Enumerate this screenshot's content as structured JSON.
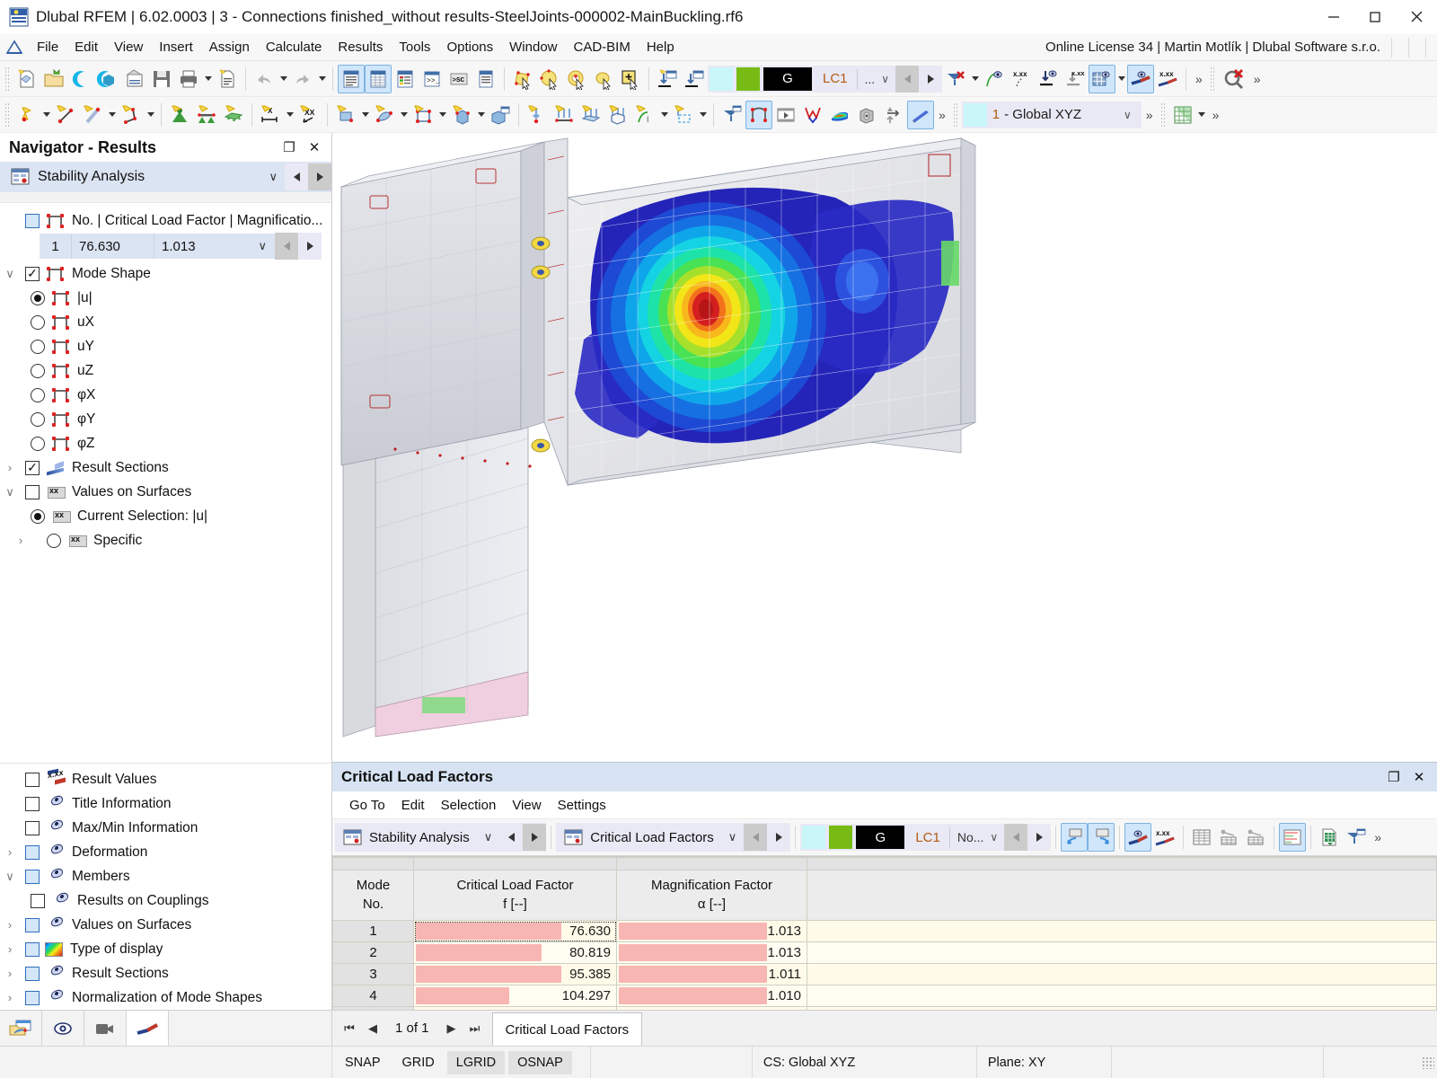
{
  "window": {
    "title": "Dlubal RFEM | 6.02.0003 | 3 - Connections finished_without results-SteelJoints-000002-MainBuckling.rf6",
    "minimize": "—",
    "maximize": "☐",
    "close": "✕"
  },
  "menubar": {
    "items": [
      "File",
      "Edit",
      "View",
      "Insert",
      "Assign",
      "Calculate",
      "Results",
      "Tools",
      "Options",
      "Window",
      "CAD-BIM",
      "Help"
    ],
    "license": "Online License 34 | Martin Motlík | Dlubal Software s.r.o."
  },
  "toolbar": {
    "load_case_selector": {
      "swatch_cyan": "#c9f6f9",
      "swatch_green": "#77bb14",
      "g_label": "G",
      "lc_label": "LC1",
      "dots": "...",
      "chevron": "∨"
    },
    "cs_selector": {
      "number": "1",
      "label": "- Global XYZ",
      "chevron": "∨"
    },
    "overflow": "»"
  },
  "navigator": {
    "title": "Navigator - Results",
    "undock_icon": "❐",
    "close_icon": "✕",
    "combo": {
      "label": "Stability Analysis",
      "chevron": "∨"
    },
    "tree": [
      {
        "label": "No. | Critical Load Factor | Magnificatio...",
        "icon": "frame-icon",
        "control": "checkbox-blue",
        "indent": 1
      },
      {
        "label": "Mode Shape",
        "icon": "frame-icon",
        "control": "checkbox-checked",
        "indent": 1,
        "expander": "∨"
      },
      {
        "label": "|u|",
        "icon": "frame-icon",
        "control": "radio-selected",
        "indent": 2
      },
      {
        "label": "uX",
        "icon": "frame-icon",
        "control": "radio",
        "indent": 2
      },
      {
        "label": "uY",
        "icon": "frame-icon",
        "control": "radio",
        "indent": 2
      },
      {
        "label": "uZ",
        "icon": "frame-icon",
        "control": "radio",
        "indent": 2
      },
      {
        "label": "φX",
        "icon": "frame-icon",
        "control": "radio",
        "indent": 2
      },
      {
        "label": "φY",
        "icon": "frame-icon",
        "control": "radio",
        "indent": 2
      },
      {
        "label": "φZ",
        "icon": "frame-icon",
        "control": "radio",
        "indent": 2
      },
      {
        "label": "Result Sections",
        "icon": "swoosh-icon",
        "control": "checkbox-checked",
        "indent": 1,
        "expander": "›"
      },
      {
        "label": "Values on Surfaces",
        "icon": "xx-tag-icon",
        "control": "checkbox",
        "indent": 1,
        "expander": "∨"
      },
      {
        "label": "Current Selection: |u|",
        "icon": "xx-tag-icon",
        "control": "radio-selected",
        "indent": 2
      },
      {
        "label": "Specific",
        "icon": "xx-tag-icon",
        "control": "radio",
        "indent": 2,
        "expander": "›"
      }
    ],
    "mode_row": {
      "no": "1",
      "critical_load_factor": "76.630",
      "magnification_factor": "1.013",
      "chevron": "∨"
    },
    "tree_bottom": [
      {
        "label": "Result Values",
        "icon": "result-values-icon",
        "control": "checkbox",
        "indent": 1
      },
      {
        "label": "Title Information",
        "icon": "eye-line-icon",
        "control": "checkbox",
        "indent": 1
      },
      {
        "label": "Max/Min Information",
        "icon": "eye-line-icon",
        "control": "checkbox",
        "indent": 1
      },
      {
        "label": "Deformation",
        "icon": "eye-line-icon",
        "control": "checkbox-blue",
        "indent": 1,
        "expander": "›"
      },
      {
        "label": "Members",
        "icon": "eye-line-icon",
        "control": "checkbox-blue",
        "indent": 1,
        "expander": "∨"
      },
      {
        "label": "Results on Couplings",
        "icon": "eye-line-icon",
        "control": "checkbox",
        "indent": 2
      },
      {
        "label": "Values on Surfaces",
        "icon": "eye-line-icon",
        "control": "checkbox-blue",
        "indent": 1,
        "expander": "›"
      },
      {
        "label": "Type of display",
        "icon": "rainbow-icon",
        "control": "checkbox-blue",
        "indent": 1,
        "expander": "›"
      },
      {
        "label": "Result Sections",
        "icon": "eye-line-icon",
        "control": "checkbox-blue",
        "indent": 1,
        "expander": "›"
      },
      {
        "label": "Normalization of Mode Shapes",
        "icon": "eye-line-icon",
        "control": "checkbox-blue",
        "indent": 1,
        "expander": "›"
      }
    ],
    "bottom_tabs": [
      "project-navigator-tab",
      "display-navigator-tab",
      "views-navigator-tab",
      "results-navigator-tab"
    ]
  },
  "results_panel": {
    "title": "Critical Load Factors",
    "undock_icon": "❐",
    "close_icon": "✕",
    "menu": [
      "Go To",
      "Edit",
      "Selection",
      "View",
      "Settings"
    ],
    "combo_left": {
      "label": "Stability Analysis",
      "chevron": "∨"
    },
    "combo_right": {
      "label": "Critical Load Factors",
      "chevron": "∨"
    },
    "load_case": {
      "swatch_cyan": "#c9f6f9",
      "swatch_green": "#77bb14",
      "g_label": "G",
      "lc_label": "LC1",
      "no_label": "No...",
      "chevron": "∨"
    },
    "table": {
      "columns": [
        {
          "title": "Mode",
          "sub": "No."
        },
        {
          "title": "Critical Load Factor",
          "sub": "f [--]"
        },
        {
          "title": "Magnification Factor",
          "sub": "α [--]"
        },
        {
          "title": "",
          "sub": ""
        }
      ],
      "rows": [
        {
          "no": "1",
          "critical": "76.630",
          "magnification": "1.013",
          "critical_pct": 72,
          "magnification_pct": 78,
          "selected": true
        },
        {
          "no": "2",
          "critical": "80.819",
          "magnification": "1.013",
          "critical_pct": 62,
          "magnification_pct": 78
        },
        {
          "no": "3",
          "critical": "95.385",
          "magnification": "1.011",
          "critical_pct": 72,
          "magnification_pct": 78
        },
        {
          "no": "4",
          "critical": "104.297",
          "magnification": "1.010",
          "critical_pct": 46,
          "magnification_pct": 78
        }
      ]
    },
    "pager": {
      "first": "⏮",
      "prev": "◀",
      "text": "1 of 1",
      "next": "▶",
      "last": "⏭",
      "tab": "Critical Load Factors"
    }
  },
  "statusbar": {
    "snap_buttons": [
      "SNAP",
      "GRID",
      "LGRID",
      "OSNAP"
    ],
    "active_snaps": [
      "LGRID",
      "OSNAP"
    ],
    "coordinate_system": "CS: Global XYZ",
    "plane": "Plane: XY"
  },
  "viewport": {
    "model": "steel-beam-column-connection-buckling-mode",
    "contour_colors": [
      "#2222bb",
      "#1b5bd8",
      "#1a9ce8",
      "#19d3e0",
      "#1fe39a",
      "#4fe24a",
      "#a8e02a",
      "#f2e61b",
      "#f8b81c",
      "#f2721b",
      "#d41f1f",
      "#b51515"
    ]
  }
}
